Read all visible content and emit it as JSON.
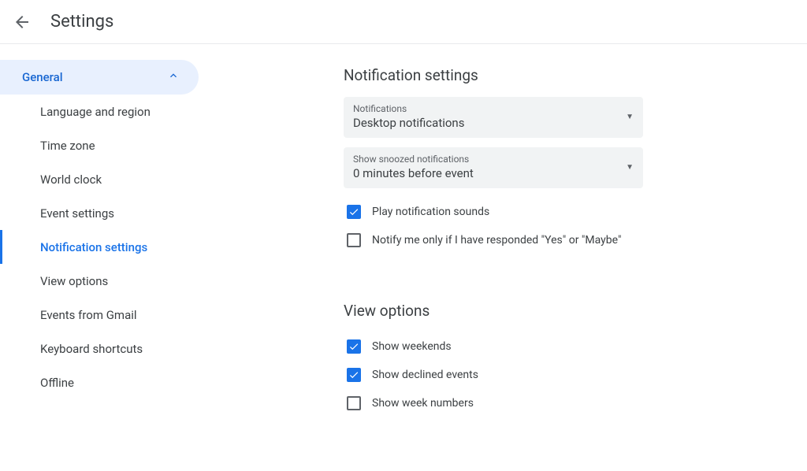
{
  "header": {
    "title": "Settings"
  },
  "sidebar": {
    "section_label": "General",
    "items": [
      {
        "label": "Language and region",
        "active": false
      },
      {
        "label": "Time zone",
        "active": false
      },
      {
        "label": "World clock",
        "active": false
      },
      {
        "label": "Event settings",
        "active": false
      },
      {
        "label": "Notification settings",
        "active": true
      },
      {
        "label": "View options",
        "active": false
      },
      {
        "label": "Events from Gmail",
        "active": false
      },
      {
        "label": "Keyboard shortcuts",
        "active": false
      },
      {
        "label": "Offline",
        "active": false
      }
    ]
  },
  "notifications": {
    "section_title": "Notification settings",
    "dropdown1": {
      "label": "Notifications",
      "value": "Desktop notifications"
    },
    "dropdown2": {
      "label": "Show snoozed notifications",
      "value": "0 minutes before event"
    },
    "checkbox1": {
      "label": "Play notification sounds",
      "checked": true
    },
    "checkbox2": {
      "label": "Notify me only if I have responded \"Yes\" or \"Maybe\"",
      "checked": false
    }
  },
  "view_options": {
    "section_title": "View options",
    "checkbox1": {
      "label": "Show weekends",
      "checked": true
    },
    "checkbox2": {
      "label": "Show declined events",
      "checked": true
    },
    "checkbox3": {
      "label": "Show week numbers",
      "checked": false
    }
  }
}
